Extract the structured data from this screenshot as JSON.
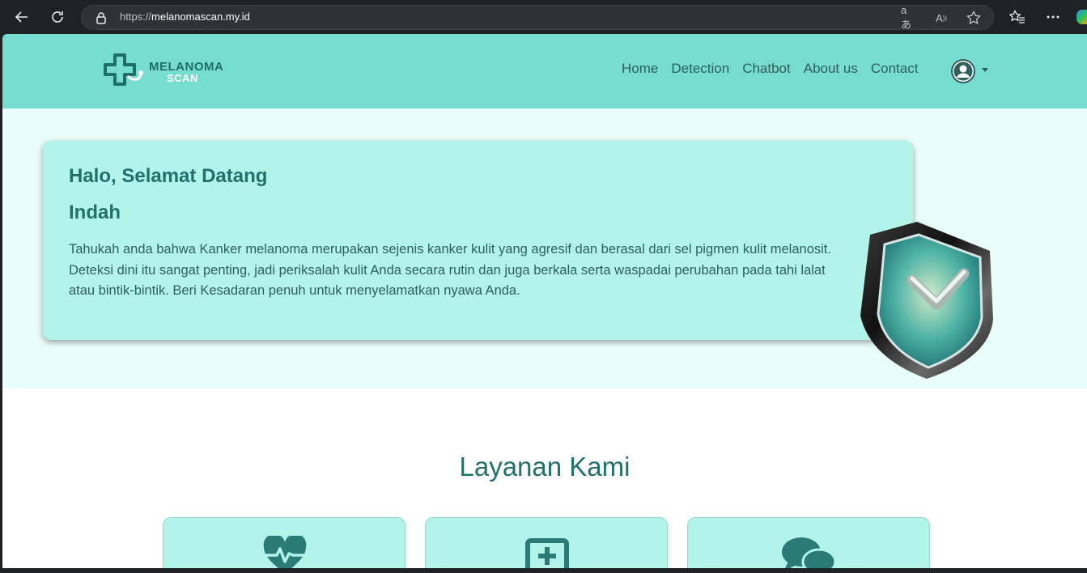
{
  "browser": {
    "url_prefix": "https://",
    "url_host": "melanomascan.my.id",
    "read_aloud_icon": "read-aloud",
    "translate_icon": "translate"
  },
  "site": {
    "logo_line1": "MELANOMA",
    "logo_line2": "SCAN",
    "nav": [
      "Home",
      "Detection",
      "Chatbot",
      "About us",
      "Contact"
    ]
  },
  "hero": {
    "title": "Halo, Selamat Datang",
    "name": "Indah",
    "text": "Tahukah anda bahwa Kanker melanoma merupakan sejenis kanker kulit yang agresif dan berasal dari sel pigmen kulit melanosit. Deteksi dini itu sangat penting, jadi periksalah kulit Anda secara rutin dan juga berkala serta waspadai perubahan pada tahi lalat atau bintik-bintik. Beri Kesadaran penuh untuk menyelamatkan nyawa Anda."
  },
  "services": {
    "title": "Layanan Kami",
    "icons": [
      "heartbeat-icon",
      "medical-kit-icon",
      "chat-bubbles-icon"
    ]
  },
  "colors": {
    "navbar": "#76ddd0",
    "card": "#b3f4ea",
    "heading": "#21706c",
    "hero_bg": "#e9fdf9"
  }
}
